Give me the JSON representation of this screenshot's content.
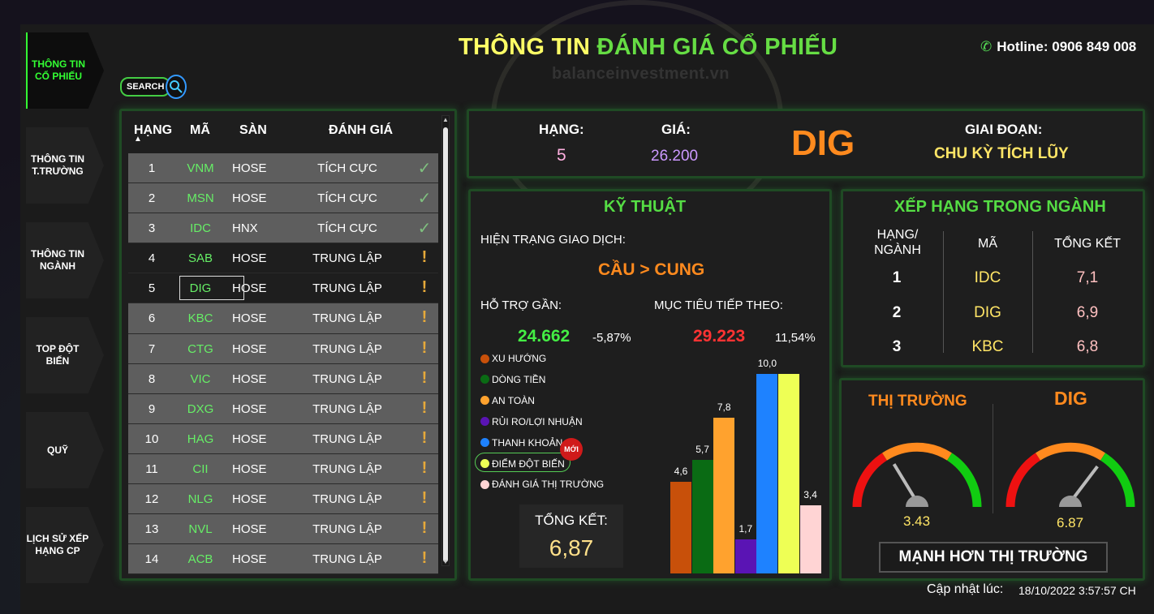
{
  "header": {
    "title_part1": "THÔNG TIN",
    "title_part2": "ĐÁNH GIÁ CỔ PHIẾU",
    "hotline": "Hotline: 0906 849 008",
    "watermark": "balanceinvestment.vn"
  },
  "sidebar": {
    "items": [
      {
        "label": "THÔNG TIN CỔ PHIẾU",
        "active": true
      },
      {
        "label": "THÔNG TIN T.TRƯỜNG",
        "active": false
      },
      {
        "label": "THÔNG TIN NGÀNH",
        "active": false
      },
      {
        "label": "TOP ĐỘT BIẾN",
        "active": false
      },
      {
        "label": "QUỸ",
        "active": false
      },
      {
        "label": "LỊCH SỬ XẾP HẠNG CP",
        "active": false
      }
    ]
  },
  "search": {
    "label": "SEARCH"
  },
  "table": {
    "headers": {
      "rank": "HẠNG",
      "code": "MÃ",
      "exchange": "SÀN",
      "rating": "ĐÁNH GIÁ"
    },
    "rows": [
      {
        "rank": "1",
        "code": "VNM",
        "exchange": "HOSE",
        "rating": "TÍCH CỰC",
        "icon": "check-icon"
      },
      {
        "rank": "2",
        "code": "MSN",
        "exchange": "HOSE",
        "rating": "TÍCH CỰC",
        "icon": "check-icon"
      },
      {
        "rank": "3",
        "code": "IDC",
        "exchange": "HNX",
        "rating": "TÍCH CỰC",
        "icon": "check-icon"
      },
      {
        "rank": "4",
        "code": "SAB",
        "exchange": "HOSE",
        "rating": "TRUNG LẬP",
        "icon": "warning-icon"
      },
      {
        "rank": "5",
        "code": "DIG",
        "exchange": "HOSE",
        "rating": "TRUNG LẬP",
        "icon": "warning-icon"
      },
      {
        "rank": "6",
        "code": "KBC",
        "exchange": "HOSE",
        "rating": "TRUNG LẬP",
        "icon": "warning-icon"
      },
      {
        "rank": "7",
        "code": "CTG",
        "exchange": "HOSE",
        "rating": "TRUNG LẬP",
        "icon": "warning-icon"
      },
      {
        "rank": "8",
        "code": "VIC",
        "exchange": "HOSE",
        "rating": "TRUNG LẬP",
        "icon": "warning-icon"
      },
      {
        "rank": "9",
        "code": "DXG",
        "exchange": "HOSE",
        "rating": "TRUNG LẬP",
        "icon": "warning-icon"
      },
      {
        "rank": "10",
        "code": "HAG",
        "exchange": "HOSE",
        "rating": "TRUNG LẬP",
        "icon": "warning-icon"
      },
      {
        "rank": "11",
        "code": "CII",
        "exchange": "HOSE",
        "rating": "TRUNG LẬP",
        "icon": "warning-icon"
      },
      {
        "rank": "12",
        "code": "NLG",
        "exchange": "HOSE",
        "rating": "TRUNG LẬP",
        "icon": "warning-icon"
      },
      {
        "rank": "13",
        "code": "NVL",
        "exchange": "HOSE",
        "rating": "TRUNG LẬP",
        "icon": "warning-icon"
      },
      {
        "rank": "14",
        "code": "ACB",
        "exchange": "HOSE",
        "rating": "TRUNG LẬP",
        "icon": "warning-icon"
      }
    ]
  },
  "summary": {
    "rank_label": "HẠNG:",
    "rank_value": "5",
    "price_label": "GIÁ:",
    "price_value": "26.200",
    "ticker": "DIG",
    "phase_label": "GIAI ĐOẠN:",
    "phase_value": "CHU KỲ TÍCH LŨY"
  },
  "technical": {
    "title": "KỸ THUẬT",
    "status_label": "HIỆN TRẠNG GIAO DỊCH:",
    "status_value": "CẦU > CUNG",
    "support_label": "HỖ TRỢ GẦN:",
    "support_value": "24.662",
    "support_pct": "-5,87%",
    "target_label": "MỤC TIÊU TIẾP THEO:",
    "target_value": "29.223",
    "target_pct": "11,54%",
    "new_badge": "MỚI",
    "total_label": "TỔNG KẾT:",
    "total_value": "6,87",
    "legend": [
      {
        "label": "XU HƯỚNG",
        "color": "#c8500a"
      },
      {
        "label": "DÒNG TIỀN",
        "color": "#0a6b14"
      },
      {
        "label": "AN TOÀN",
        "color": "#ffa22e"
      },
      {
        "label": "RỦI RO/LỢI NHUẬN",
        "color": "#5a14b4"
      },
      {
        "label": "THANH KHOẢN",
        "color": "#1e82ff"
      },
      {
        "label": "ĐIỂM ĐỘT BIẾN",
        "color": "#eeff55"
      },
      {
        "label": "ĐÁNH GIÁ THỊ TRƯỜNG",
        "color": "#ffd4d4"
      }
    ]
  },
  "chart_data": {
    "type": "bar",
    "categories": [
      "XU HƯỚNG",
      "DÒNG TIỀN",
      "AN TOÀN",
      "RỦI RO/LỢI NHUẬN",
      "THANH KHOẢN",
      "ĐIỂM ĐỘT BIẾN",
      "ĐÁNH GIÁ THỊ TRƯỜNG"
    ],
    "values": [
      4.6,
      5.7,
      7.8,
      1.7,
      10.0,
      10.0,
      3.4
    ],
    "value_labels": [
      "4,6",
      "5,7",
      "7,8",
      "1,7",
      "10,0",
      "",
      "3,4"
    ],
    "colors": [
      "#c8500a",
      "#0a6b14",
      "#ffa22e",
      "#5a14b4",
      "#1e82ff",
      "#eeff55",
      "#ffd4d4"
    ],
    "ylim": [
      0,
      10
    ],
    "title": "",
    "xlabel": "",
    "ylabel": ""
  },
  "industry": {
    "title": "XẾP HẠNG TRONG NGÀNH",
    "headers": {
      "rank": "HẠNG/ NGÀNH",
      "code": "MÃ",
      "total": "TỔNG KẾT"
    },
    "rows": [
      {
        "rank": "1",
        "code": "IDC",
        "total": "7,1"
      },
      {
        "rank": "2",
        "code": "DIG",
        "total": "6,9"
      },
      {
        "rank": "3",
        "code": "KBC",
        "total": "6,8"
      }
    ]
  },
  "gauges": {
    "market_title": "THỊ TRƯỜNG",
    "market_value": "3.43",
    "market_level": 0.343,
    "stock_title": "DIG",
    "stock_value": "6.87",
    "stock_level": 0.687,
    "verdict": "MẠNH HƠN THỊ TRƯỜNG"
  },
  "footer": {
    "updated_label": "Cập nhật lúc:",
    "updated_value": "18/10/2022 3:57:57 CH"
  }
}
